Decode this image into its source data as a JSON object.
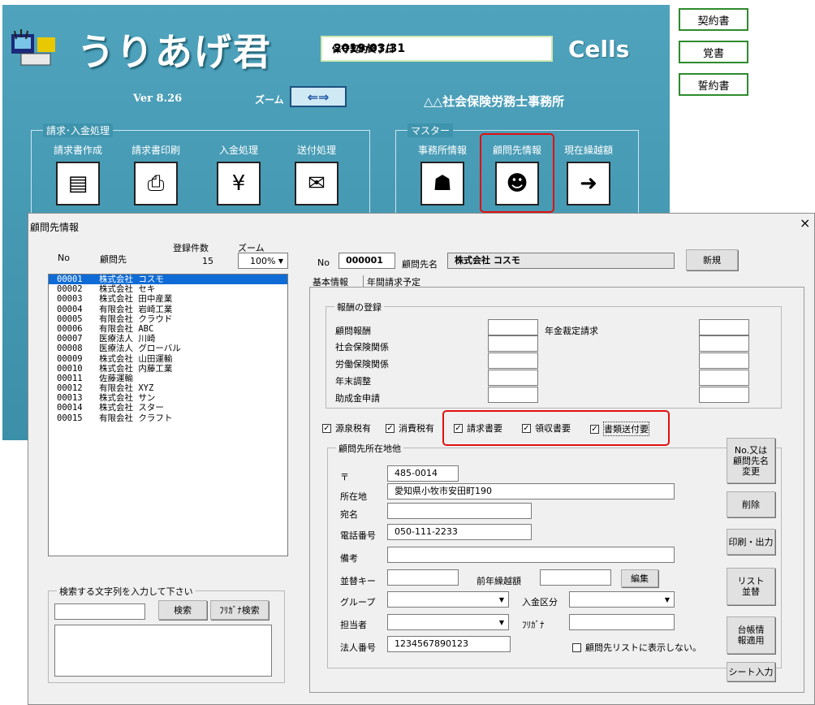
{
  "app": {
    "title": "うりあげ君",
    "version": "Ver 8.26",
    "zoom_label": "ズーム",
    "zoom_icon": "arrows-icon",
    "brand": "Cells",
    "office": "△△社会保険労務士事務所",
    "expiry": {
      "label": "保守契約終了日",
      "value": "2019/03/31"
    },
    "groups": {
      "billing": "請求･入金処理",
      "master": "マスター"
    },
    "tiles": {
      "invoice_create": "請求書作成",
      "invoice_print": "請求書印刷",
      "payment": "入金処理",
      "send": "送付処理",
      "office_info": "事務所情報",
      "client_info": "顧問先情報",
      "carryover": "現在繰越額"
    },
    "side_buttons": {
      "contract": "契約書",
      "memo": "覚書",
      "pledge": "誓約書"
    }
  },
  "dialog": {
    "title": "顧問先情報",
    "close": "×",
    "list_header": {
      "no": "No",
      "client": "顧問先",
      "count_label": "登録件数",
      "count": "15",
      "zoom_label": "ズーム",
      "zoom_value": "100%"
    },
    "clients": [
      {
        "no": "00001",
        "name": "株式会社 コスモ"
      },
      {
        "no": "00002",
        "name": "株式会社 セキ"
      },
      {
        "no": "00003",
        "name": "株式会社 田中産業"
      },
      {
        "no": "00004",
        "name": "有限会社 岩崎工業"
      },
      {
        "no": "00005",
        "name": "有限会社 クラウド"
      },
      {
        "no": "00006",
        "name": "有限会社 ABC"
      },
      {
        "no": "00007",
        "name": "医療法人 川崎"
      },
      {
        "no": "00008",
        "name": "医療法人 グローバル"
      },
      {
        "no": "00009",
        "name": "株式会社 山田運輸"
      },
      {
        "no": "00010",
        "name": "株式会社 内藤工業"
      },
      {
        "no": "00011",
        "name": "佐藤運輸"
      },
      {
        "no": "00012",
        "name": "有限会社 XYZ"
      },
      {
        "no": "00013",
        "name": "株式会社 サン"
      },
      {
        "no": "00014",
        "name": "株式会社 スター"
      },
      {
        "no": "00015",
        "name": "有限会社 クラフト"
      }
    ],
    "search": {
      "group": "検索する文字列を入力して下さい",
      "search_btn": "検索",
      "kana_btn": "ﾌﾘｶﾞﾅ検索"
    },
    "header": {
      "no_label": "No",
      "no_value": "000001",
      "name_label": "顧問先名",
      "name_value": "株式会社 コスモ",
      "new_btn": "新規"
    },
    "tabs": [
      "基本情報",
      "年間請求予定"
    ],
    "fees": {
      "group": "報酬の登録",
      "labels": [
        "顧問報酬",
        "社会保険関係",
        "労働保険関係",
        "年末調整",
        "助成金申請"
      ],
      "annual": "年金裁定請求"
    },
    "checks": [
      {
        "label": "源泉税有",
        "checked": true
      },
      {
        "label": "消費税有",
        "checked": true
      },
      {
        "label": "請求書要",
        "checked": true
      },
      {
        "label": "領収書要",
        "checked": true
      },
      {
        "label": "書類送付要",
        "checked": true
      }
    ],
    "address": {
      "group": "顧問先所在地他",
      "postal_label": "〒",
      "postal": "485-0014",
      "addr_label": "所在地",
      "addr": "愛知県小牧市安田町190",
      "dest_label": "宛名",
      "tel_label": "電話番号",
      "tel": "050-111-2233",
      "note_label": "備考",
      "sort_label": "並替キー",
      "prev_label": "前年繰越額",
      "edit_btn": "編集",
      "group_label": "グループ",
      "pay_label": "入金区分",
      "staff_label": "担当者",
      "kana_label": "ﾌﾘｶﾞﾅ",
      "corp_label": "法人番号",
      "corp": "1234567890123",
      "hide_label": "顧問先リストに表示しない。"
    },
    "right_buttons": {
      "change": "No.又は\n顧問先名\n変更",
      "delete": "削除",
      "print": "印刷・出力",
      "sort": "リスト\n並替",
      "ledger": "台帳情\n報適用",
      "sheet": "シート入力"
    }
  }
}
